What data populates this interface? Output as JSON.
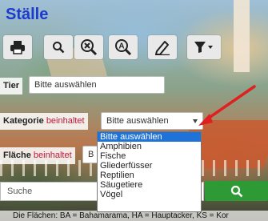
{
  "page": {
    "title": "Ställe"
  },
  "toolbar": {
    "icons": [
      "print-icon",
      "zoom-icon",
      "clear-icon",
      "search-a-icon",
      "edit-icon",
      "filter-icon"
    ]
  },
  "filters": {
    "tier": {
      "label": "Tier",
      "value": "Bitte auswählen"
    },
    "kategorie": {
      "label": "Kategorie",
      "operator": "beinhaltet",
      "value": "Bitte auswählen",
      "options": [
        "Bitte auswählen",
        "Amphibien",
        "Fische",
        "Gliederfüsser",
        "Reptilien",
        "Säugetiere",
        "Vögel"
      ]
    },
    "flaeche": {
      "label": "Fläche",
      "operator": "beinhaltet",
      "value": "B"
    }
  },
  "search": {
    "placeholder": "Suche"
  },
  "footer": {
    "text": "Die Flächen: BA = Bahamarama, HA = Hauptacker, KS = Kor"
  },
  "colors": {
    "title": "#1a3ad0",
    "search_button": "#2d9a35",
    "selected_option": "#1e72d8",
    "operator": "#c0183c",
    "annotation_arrow": "#e02020"
  }
}
